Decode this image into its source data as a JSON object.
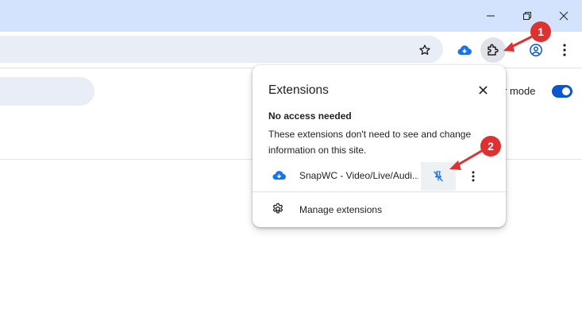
{
  "window": {
    "minimize_icon": "minimize-icon",
    "restore_icon": "restore-icon",
    "close_icon": "close-icon"
  },
  "toolbar": {
    "bookmark_icon": "star-icon",
    "snapwc_icon": "cloud-download-icon",
    "extensions_icon": "puzzle-icon",
    "profile_icon": "account-circle-icon",
    "menu_icon": "kebab-menu-icon"
  },
  "page": {
    "mode_label": "r mode",
    "toggle_on": true
  },
  "extensions_popup": {
    "title": "Extensions",
    "section_heading": "No access needed",
    "section_description": "These extensions don't need to see and change information on this site.",
    "extensions": [
      {
        "name": "SnapWC - Video/Live/Audi...",
        "icon": "cloud-download-icon",
        "pinned": false
      }
    ],
    "manage_label": "Manage extensions",
    "manage_icon": "gear-icon"
  },
  "annotations": {
    "callout_1": "1",
    "callout_2": "2",
    "color": "#e03131"
  },
  "colors": {
    "titlebar": "#d3e3fd",
    "accent": "#0b57d0",
    "omnibox": "#e9eef6",
    "snapwc_icon": "#1a73e8"
  }
}
